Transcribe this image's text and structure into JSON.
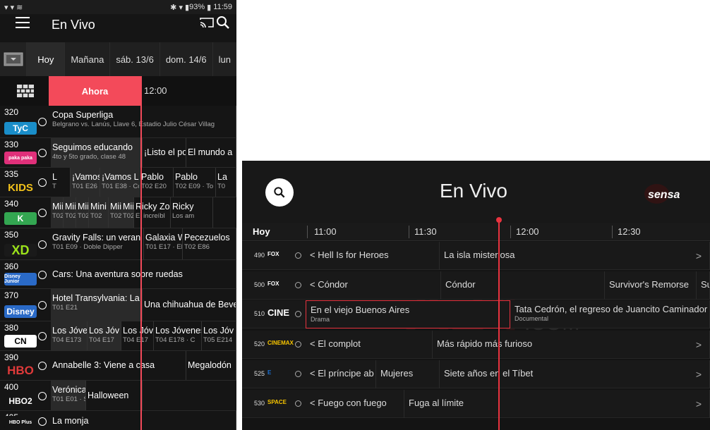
{
  "phone": {
    "status": {
      "time": "11:59",
      "battery": "93%"
    },
    "title": "En Vivo",
    "days": [
      "Hoy",
      "Mañana",
      "sáb. 13/6",
      "dom. 14/6",
      "lun"
    ],
    "now_label": "Ahora",
    "time_slot": "12:00",
    "rows": [
      {
        "ch": "320",
        "logo": "TyC",
        "logo_bg": "#1a8ec9",
        "progs": [
          {
            "t": "Copa Superliga",
            "s": "Belgrano vs. Lanús, Llave 6, Estadio Julio César Villag"
          }
        ]
      },
      {
        "ch": "330",
        "logo": "paka paka",
        "logo_bg": "#e0307a",
        "progs": [
          {
            "t": "Seguimos educando",
            "s": "4to y 5to grado, clase 48"
          },
          {
            "t": "¡Listo el po",
            "s": ""
          },
          {
            "t": "El mundo a",
            "s": ""
          }
        ]
      },
      {
        "ch": "335",
        "logo": "KIDS",
        "logo_bg": "#f2c21b",
        "progs": [
          {
            "t": "L",
            "s": "T"
          },
          {
            "t": "¡Vamos",
            "s": "T01 E26 ·"
          },
          {
            "t": "¡Vamos Lu",
            "s": "T01 E38 · Co"
          },
          {
            "t": "Pablo",
            "s": "T02 E20"
          },
          {
            "t": "Pablo",
            "s": "T02 E09 · To"
          },
          {
            "t": "La",
            "s": "T0"
          }
        ]
      },
      {
        "ch": "340",
        "logo": "K",
        "logo_bg": "#33a651",
        "progs": [
          {
            "t": "Mii",
            "s": "T02"
          },
          {
            "t": "Mii",
            "s": "T02"
          },
          {
            "t": "Mii",
            "s": "T02 E2"
          },
          {
            "t": "Mini B",
            "s": "T02"
          },
          {
            "t": "Mii",
            "s": "T02"
          },
          {
            "t": "Mii",
            "s": "T02"
          },
          {
            "t": "Ricky Zo",
            "s": "El increíbl"
          },
          {
            "t": "Ricky",
            "s": "Los am"
          }
        ]
      },
      {
        "ch": "350",
        "logo": "XD",
        "logo_bg": "#1a1a1a",
        "progs": [
          {
            "t": "Gravity Falls: un veran",
            "s": "T01 E09 · Doble Dipper"
          },
          {
            "t": "Galaxia Wa",
            "s": "T01 E17 · El"
          },
          {
            "t": "Pecezuelos",
            "s": "T02 E86"
          }
        ]
      },
      {
        "ch": "360",
        "logo": "Disney Junior",
        "logo_bg": "#2a6ac7",
        "progs": [
          {
            "t": "Cars: Una aventura sobre ruedas",
            "s": ""
          }
        ]
      },
      {
        "ch": "370",
        "logo": "Disney",
        "logo_bg": "#2a6ac7",
        "progs": [
          {
            "t": "Hotel Transylvania: La",
            "s": "T01 E21"
          },
          {
            "t": "Una chihuahua de Beve",
            "s": ""
          }
        ]
      },
      {
        "ch": "380",
        "logo": "CN",
        "logo_bg": "#ffffff",
        "progs": [
          {
            "t": "Los Jóve",
            "s": "T04 E173"
          },
          {
            "t": "Los Jóv",
            "s": "T04 E17"
          },
          {
            "t": "Los Jóv",
            "s": "T04 E17"
          },
          {
            "t": "Los Jóvenes",
            "s": "T04 E178 · C"
          },
          {
            "t": "Los Jóv",
            "s": "T05 E214"
          }
        ]
      },
      {
        "ch": "390",
        "logo": "HBO",
        "logo_bg": "#151515",
        "progs": [
          {
            "t": "Annabelle 3: Viene a casa",
            "s": ""
          },
          {
            "t": "Megalodón",
            "s": ""
          }
        ]
      },
      {
        "ch": "400",
        "logo": "HBO2",
        "logo_bg": "#151515",
        "progs": [
          {
            "t": "Verónica M",
            "s": "T01 E01 · Sp"
          },
          {
            "t": "Halloween",
            "s": ""
          }
        ]
      },
      {
        "ch": "405",
        "logo": "HBO Plus",
        "logo_bg": "#151515",
        "progs": [
          {
            "t": "La monja",
            "s": ""
          }
        ]
      }
    ]
  },
  "tv": {
    "title": "En Vivo",
    "brand": "sensa",
    "day": "Hoy",
    "times": [
      "11:00",
      "11:30",
      "12:00",
      "12:30"
    ],
    "rows": [
      {
        "ch": "490",
        "logo": "FOX",
        "cells": [
          {
            "t": "< Hell Is for Heroes",
            "s": ""
          },
          {
            "t": "La isla misteriosa",
            "s": ""
          }
        ],
        "arrow": ">"
      },
      {
        "ch": "500",
        "logo": "FOX",
        "cells": [
          {
            "t": "< Cóndor",
            "s": ""
          },
          {
            "t": "Cóndor",
            "s": ""
          },
          {
            "t": "Survivor's Remorse",
            "s": ""
          },
          {
            "t": "Su",
            "s": ""
          }
        ],
        "arrow": ""
      },
      {
        "ch": "510",
        "logo": "CINE",
        "cells": [
          {
            "t": "En el viejo Buenos Aires",
            "s": "Drama"
          },
          {
            "t": "Tata Cedrón, el regreso de Juancito Caminador",
            "s": "Documental"
          }
        ],
        "arrow": ""
      },
      {
        "ch": "520",
        "logo": "CINEMAX",
        "cells": [
          {
            "t": "< El complot",
            "s": ""
          },
          {
            "t": "Más rápido más furioso",
            "s": ""
          }
        ],
        "arrow": ">"
      },
      {
        "ch": "525",
        "logo": "E",
        "cells": [
          {
            "t": "< El príncipe ab",
            "s": ""
          },
          {
            "t": "Mujeres",
            "s": ""
          },
          {
            "t": "Siete años en el Tíbet",
            "s": ""
          }
        ],
        "arrow": ">"
      },
      {
        "ch": "530",
        "logo": "SPACE",
        "cells": [
          {
            "t": "< Fuego con fuego",
            "s": ""
          },
          {
            "t": "Fuga al límite",
            "s": ""
          }
        ],
        "arrow": ">"
      }
    ]
  }
}
